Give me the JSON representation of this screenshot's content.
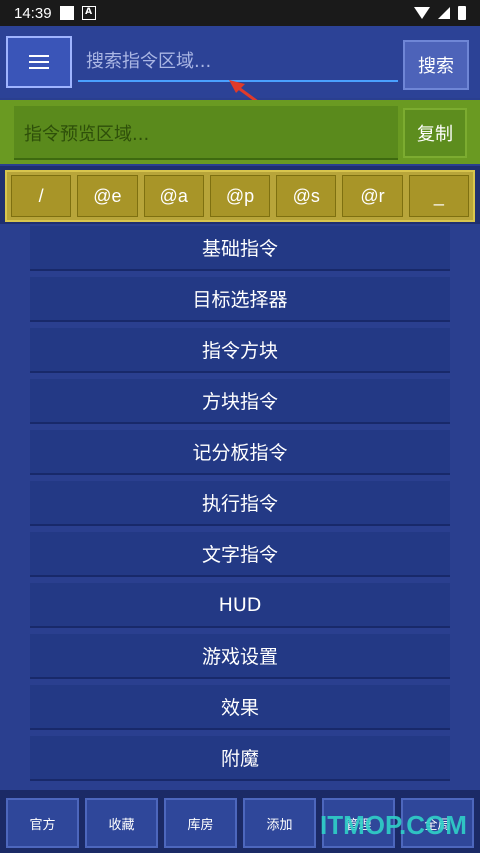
{
  "status_bar": {
    "time": "14:39",
    "notif_icon": "A"
  },
  "search": {
    "placeholder": "搜索指令区域...",
    "button_label": "搜索"
  },
  "preview": {
    "placeholder": "指令预览区域...",
    "copy_label": "复制"
  },
  "selectors": [
    "/",
    "@e",
    "@a",
    "@p",
    "@s",
    "@r",
    "_"
  ],
  "commands": [
    "基础指令",
    "目标选择器",
    "指令方块",
    "方块指令",
    "记分板指令",
    "执行指令",
    "文字指令",
    "HUD",
    "游戏设置",
    "效果",
    "附魔"
  ],
  "bottom_nav": [
    "官方",
    "收藏",
    "库房",
    "添加",
    "管理",
    "全局"
  ],
  "watermark": "ITMOP.COM",
  "colors": {
    "background": "#2a3f8f",
    "preview_green": "#6a9a22",
    "selector_gold": "#b8a53a",
    "arrow_red": "#e03a2a",
    "watermark_cyan": "#2fd1c8"
  }
}
